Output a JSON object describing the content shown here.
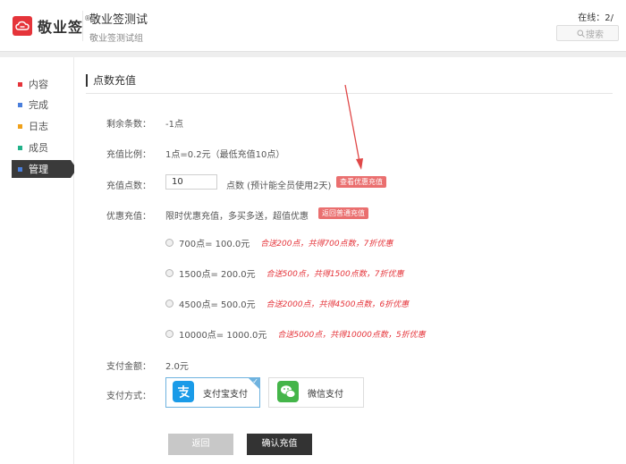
{
  "header": {
    "logo_text": "敬业签",
    "logo_reg": "®",
    "project_title": "敬业签测试",
    "project_subtitle": "敬业签测试组",
    "online": "在线：2/",
    "search_placeholder": "搜索"
  },
  "sidebar": {
    "items": [
      {
        "label": "内容",
        "color": "#e5343a"
      },
      {
        "label": "完成",
        "color": "#4a7fdc"
      },
      {
        "label": "日志",
        "color": "#f0a11a"
      },
      {
        "label": "成员",
        "color": "#22b28a"
      },
      {
        "label": "管理",
        "color": "#4a7fdc"
      }
    ],
    "active": "管理"
  },
  "main": {
    "section_title": "点数充值",
    "remaining_label": "剩余条数：",
    "remaining_value": "-1点",
    "ratio_label": "充值比例：",
    "ratio_value": "1点=0.2元（最低充值10点）",
    "points_label": "充值点数：",
    "points_value": "10",
    "points_hint": "点数 (预计能全员使用2天)",
    "view_promo_tag": "查看优惠充值",
    "promo_label": "优惠充值：",
    "promo_desc": "限时优惠充值，多买多送，超值优惠",
    "back_normal_tag": "返回普通充值",
    "options": [
      {
        "price": "700点= 100.0元",
        "promo": "合送200点，共得700点数，7折优惠"
      },
      {
        "price": "1500点= 200.0元",
        "promo": "合送500点，共得1500点数，7折优惠"
      },
      {
        "price": "4500点= 500.0元",
        "promo": "合送2000点，共得4500点数，6折优惠"
      },
      {
        "price": "10000点= 1000.0元",
        "promo": "合送5000点，共得10000点数，5折优惠"
      }
    ],
    "amount_label": "支付金额：",
    "amount_value": "2.0元",
    "method_label": "支付方式：",
    "alipay_label": "支付宝支付",
    "wechat_label": "微信支付",
    "back_button": "返回",
    "confirm_button": "确认充值"
  },
  "colors": {
    "brand_red": "#e5343a",
    "alipay_blue": "#1a9be8",
    "wechat_green": "#44b549",
    "selected_border": "#6fb3df"
  }
}
